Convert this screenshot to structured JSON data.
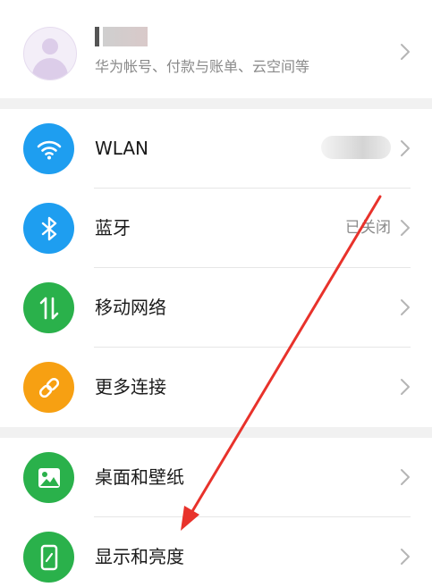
{
  "account": {
    "subtitle": "华为帐号、付款与账单、云空间等",
    "icon": "avatar-icon"
  },
  "connectivity": [
    {
      "label": "WLAN",
      "status": "",
      "icon": "wifi-icon",
      "color": "#1e9ef0"
    },
    {
      "label": "蓝牙",
      "status": "已关闭",
      "icon": "bluetooth-icon",
      "color": "#1e9ef0"
    },
    {
      "label": "移动网络",
      "status": "",
      "icon": "mobile-data-icon",
      "color": "#2ab14b"
    },
    {
      "label": "更多连接",
      "status": "",
      "icon": "link-icon",
      "color": "#f7a012"
    }
  ],
  "display": [
    {
      "label": "桌面和壁纸",
      "icon": "image-icon",
      "color": "#2ab14b"
    },
    {
      "label": "显示和亮度",
      "icon": "phone-brightness-icon",
      "color": "#2ab14b"
    }
  ],
  "annotation": {
    "color": "#e8322b",
    "icon": "arrow-annotation"
  }
}
